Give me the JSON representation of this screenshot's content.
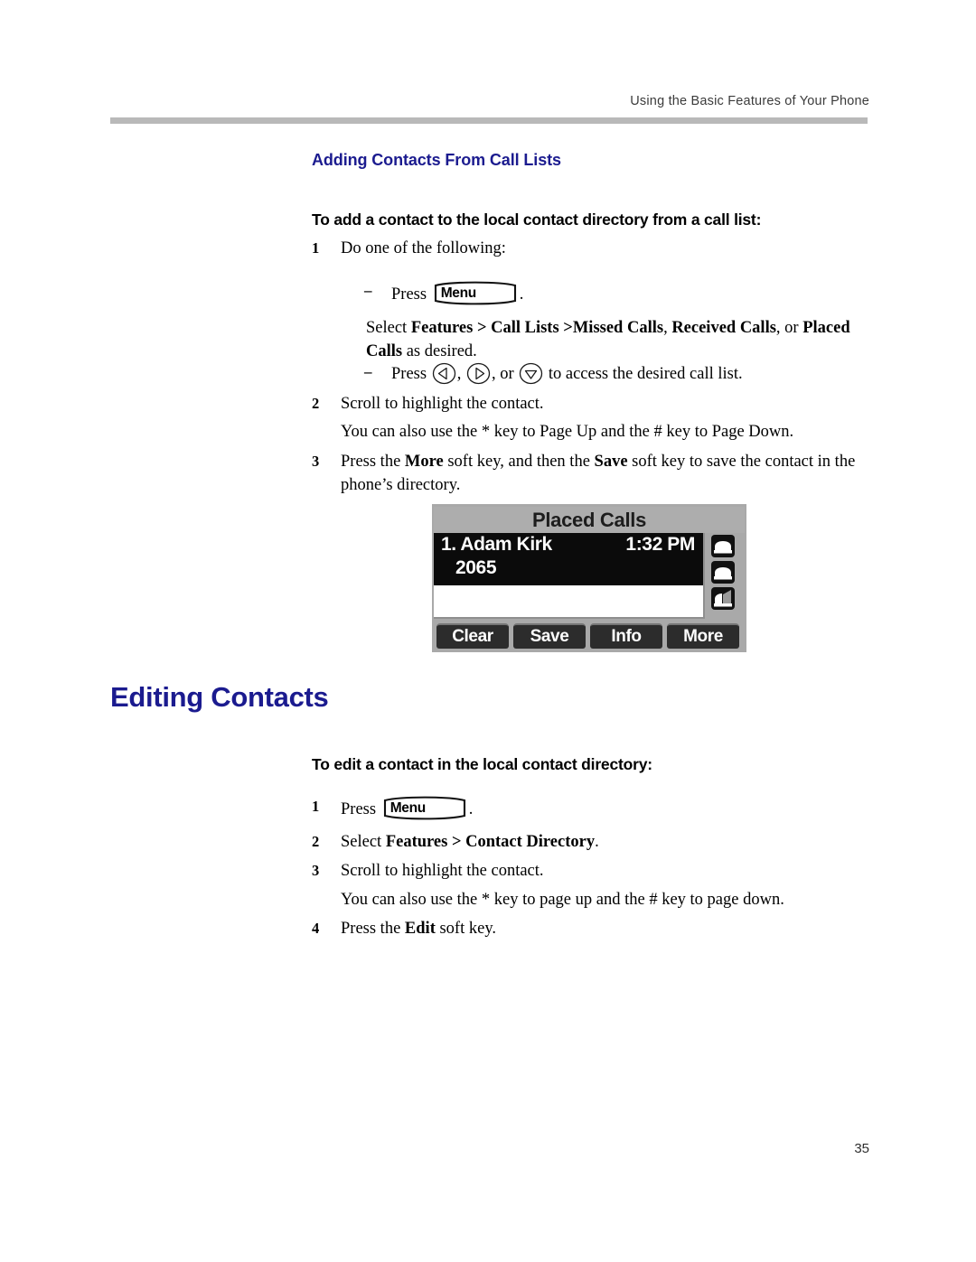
{
  "header": {
    "running_head": "Using the Basic Features of Your Phone",
    "rule_color": "#b9b9b9"
  },
  "colors": {
    "heading_blue": "#1b1b8f",
    "lcd_selected_bg": "#0b0b0b",
    "lcd_chrome": "#a9a9a9"
  },
  "headings": {
    "section_h2": "Adding Contacts From Call Lists",
    "section_h1": "Editing Contacts"
  },
  "procedure_1": {
    "title": "To add a contact to the local contact directory from a call list:",
    "steps": [
      {
        "num": "1",
        "text": "Do one of the following:"
      }
    ],
    "bullet_1": {
      "dash": "–",
      "press_label": "Press",
      "key_label": "Menu",
      "trailing": "."
    },
    "select_line": {
      "lead": "Select ",
      "b1": "Features > Call Lists >Missed Calls",
      "sep1": ", ",
      "b2": "Received Calls",
      "sep2": ", or ",
      "b3": "Placed Calls",
      "tail": " as desired."
    },
    "bullet_2": {
      "dash": "–",
      "press_label": "Press",
      "comma1": ",",
      "comma2": ", or",
      "tail": "to access the desired call list.",
      "keys": [
        "left-arrow-key",
        "right-arrow-key",
        "down-arrow-key"
      ]
    },
    "step_2": {
      "num": "2",
      "text": "Scroll to highlight the contact.",
      "note": "You can also use the * key to Page Up and the # key to Page Down."
    },
    "step_3": {
      "num": "3",
      "pre": "Press the ",
      "b1": "More",
      "mid": " soft key, and then the ",
      "b2": "Save",
      "post": " soft key to save the contact in the phone’s directory."
    }
  },
  "lcd_figure": {
    "title": "Placed Calls",
    "selected_entry": {
      "name": "1. Adam Kirk",
      "time": "1:32 PM",
      "number": "2065"
    },
    "line_keys": [
      "line-key-icon",
      "line-key-icon",
      "line-key-icon"
    ],
    "soft_keys": [
      "Clear",
      "Save",
      "Info",
      "More"
    ]
  },
  "procedure_2": {
    "title": "To edit a contact in the local contact directory:",
    "step_1": {
      "num": "1",
      "press_label": "Press",
      "key_label": "Menu",
      "trailing": "."
    },
    "step_2": {
      "num": "2",
      "lead": "Select ",
      "bold": "Features > Contact Directory",
      "tail": "."
    },
    "step_3": {
      "num": "3",
      "text": "Scroll to highlight the contact.",
      "note": "You can also use the * key to page up and the # key to page down."
    },
    "step_4": {
      "num": "4",
      "pre": "Press the ",
      "bold": "Edit",
      "post": " soft key."
    }
  },
  "footer": {
    "page_number": "35"
  }
}
